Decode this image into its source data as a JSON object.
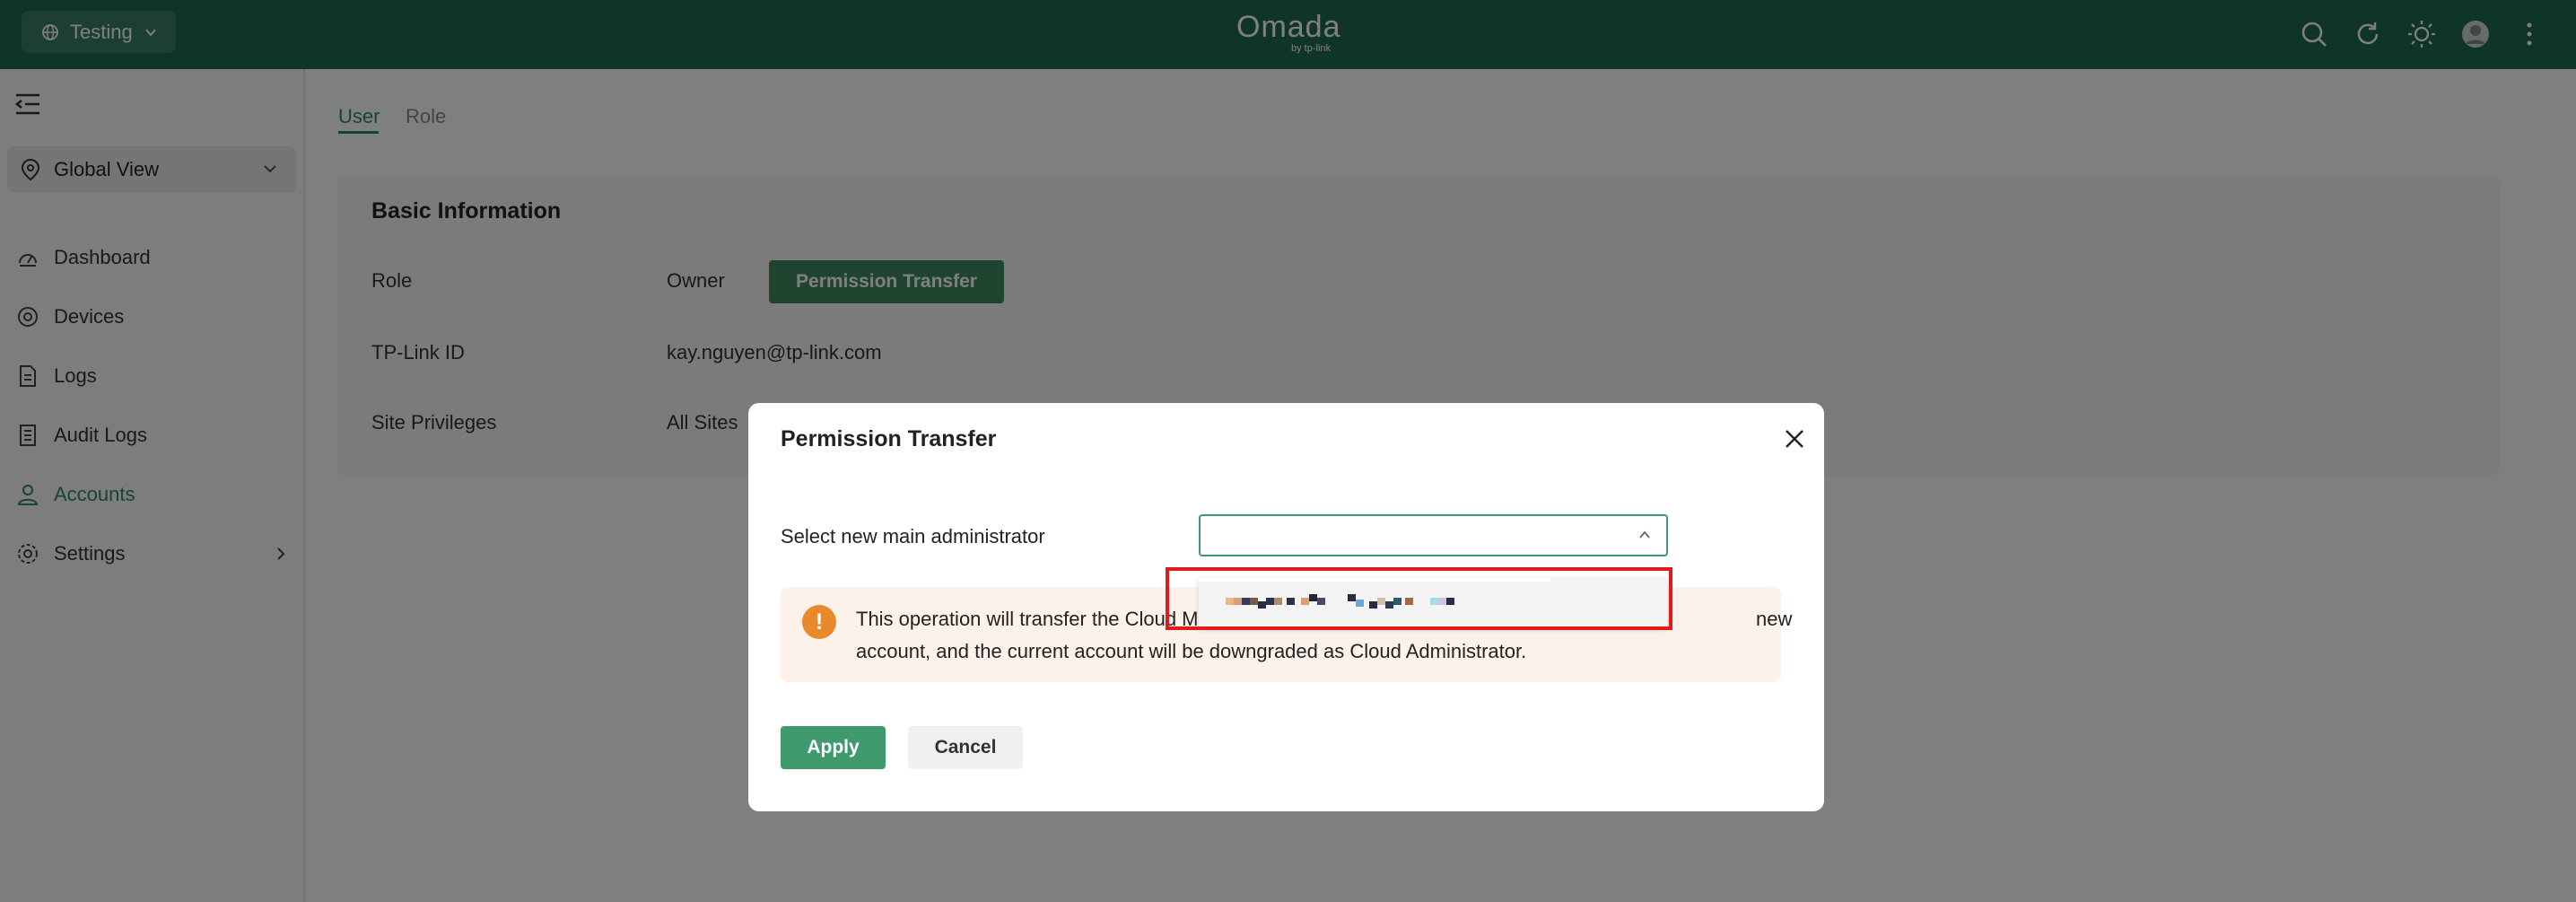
{
  "topbar": {
    "site_selector": "Testing",
    "brand_name": "Omada",
    "brand_sub": "by tp-link",
    "icons": [
      "search-icon",
      "refresh-icon",
      "theme-icon",
      "avatar",
      "more-icon"
    ]
  },
  "sidebar": {
    "scope": "Global View",
    "items": [
      {
        "label": "Dashboard",
        "icon": "dashboard-icon"
      },
      {
        "label": "Devices",
        "icon": "devices-icon"
      },
      {
        "label": "Logs",
        "icon": "logs-icon"
      },
      {
        "label": "Audit Logs",
        "icon": "audit-logs-icon"
      },
      {
        "label": "Accounts",
        "icon": "accounts-icon",
        "active": true
      },
      {
        "label": "Settings",
        "icon": "settings-icon"
      }
    ]
  },
  "tabs": [
    {
      "label": "User",
      "active": true
    },
    {
      "label": "Role",
      "active": false
    }
  ],
  "basic_info": {
    "title": "Basic Information",
    "role_label": "Role",
    "role_value": "Owner",
    "transfer_button": "Permission Transfer",
    "id_label": "TP-Link ID",
    "id_value": "kay.nguyen@tp-link.com",
    "privileges_label": "Site Privileges",
    "privileges_value": "All Sites"
  },
  "modal": {
    "title": "Permission Transfer",
    "select_label": "Select new main administrator",
    "select_value": "",
    "warning_line1": "This operation will transfer the Cloud Mai",
    "warning_line1_tail": "new",
    "warning_line2": "account, and the current account will be downgraded as Cloud Administrator.",
    "apply_label": "Apply",
    "cancel_label": "Cancel"
  },
  "colors": {
    "topbar": "#1e6b52",
    "accent": "#3f9a6d",
    "active_nav": "#2f8a67",
    "warning": "#e8892b",
    "highlight": "#e01b1b"
  }
}
